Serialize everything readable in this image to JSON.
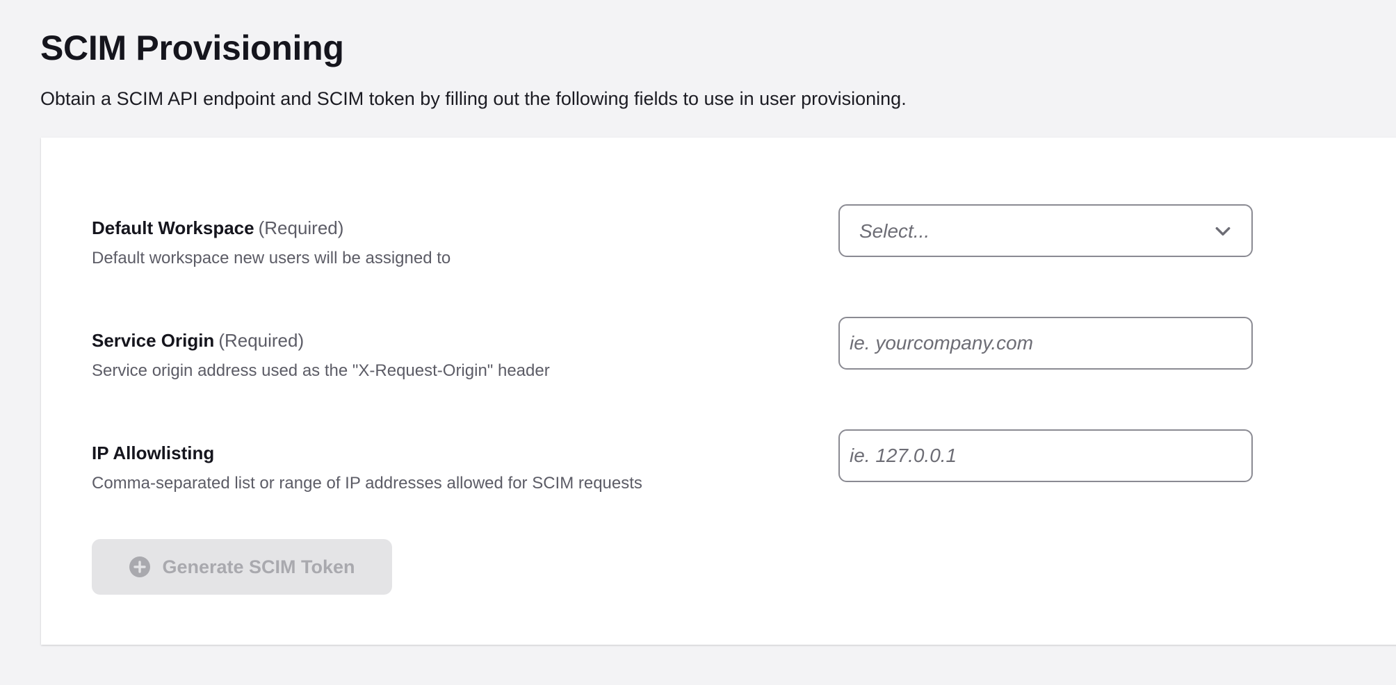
{
  "header": {
    "title": "SCIM Provisioning",
    "description": "Obtain a SCIM API endpoint and SCIM token by filling out the following fields to use in user provisioning."
  },
  "form": {
    "default_workspace": {
      "label": "Default Workspace",
      "required": "(Required)",
      "help": "Default workspace new users will be assigned to",
      "selected_value": "Select...",
      "icon": "chevron-down-icon"
    },
    "service_origin": {
      "label": "Service Origin",
      "required": "(Required)",
      "help": "Service origin address used as the \"X-Request-Origin\" header",
      "value": "",
      "placeholder": "ie. yourcompany.com"
    },
    "ip_allowlisting": {
      "label": "IP Allowlisting",
      "help": "Comma-separated list or range of IP addresses allowed for SCIM requests",
      "value": "",
      "placeholder": "ie. 127.0.0.1"
    },
    "generate_button": {
      "label": "Generate SCIM Token",
      "icon": "plus-circle-icon",
      "state": "disabled"
    }
  },
  "colors": {
    "page_background": "#f3f3f5",
    "card_background": "#ffffff",
    "input_border": "#8a8a92",
    "disabled_button_bg": "#e4e4e6",
    "disabled_button_text": "#a9a9ae"
  }
}
